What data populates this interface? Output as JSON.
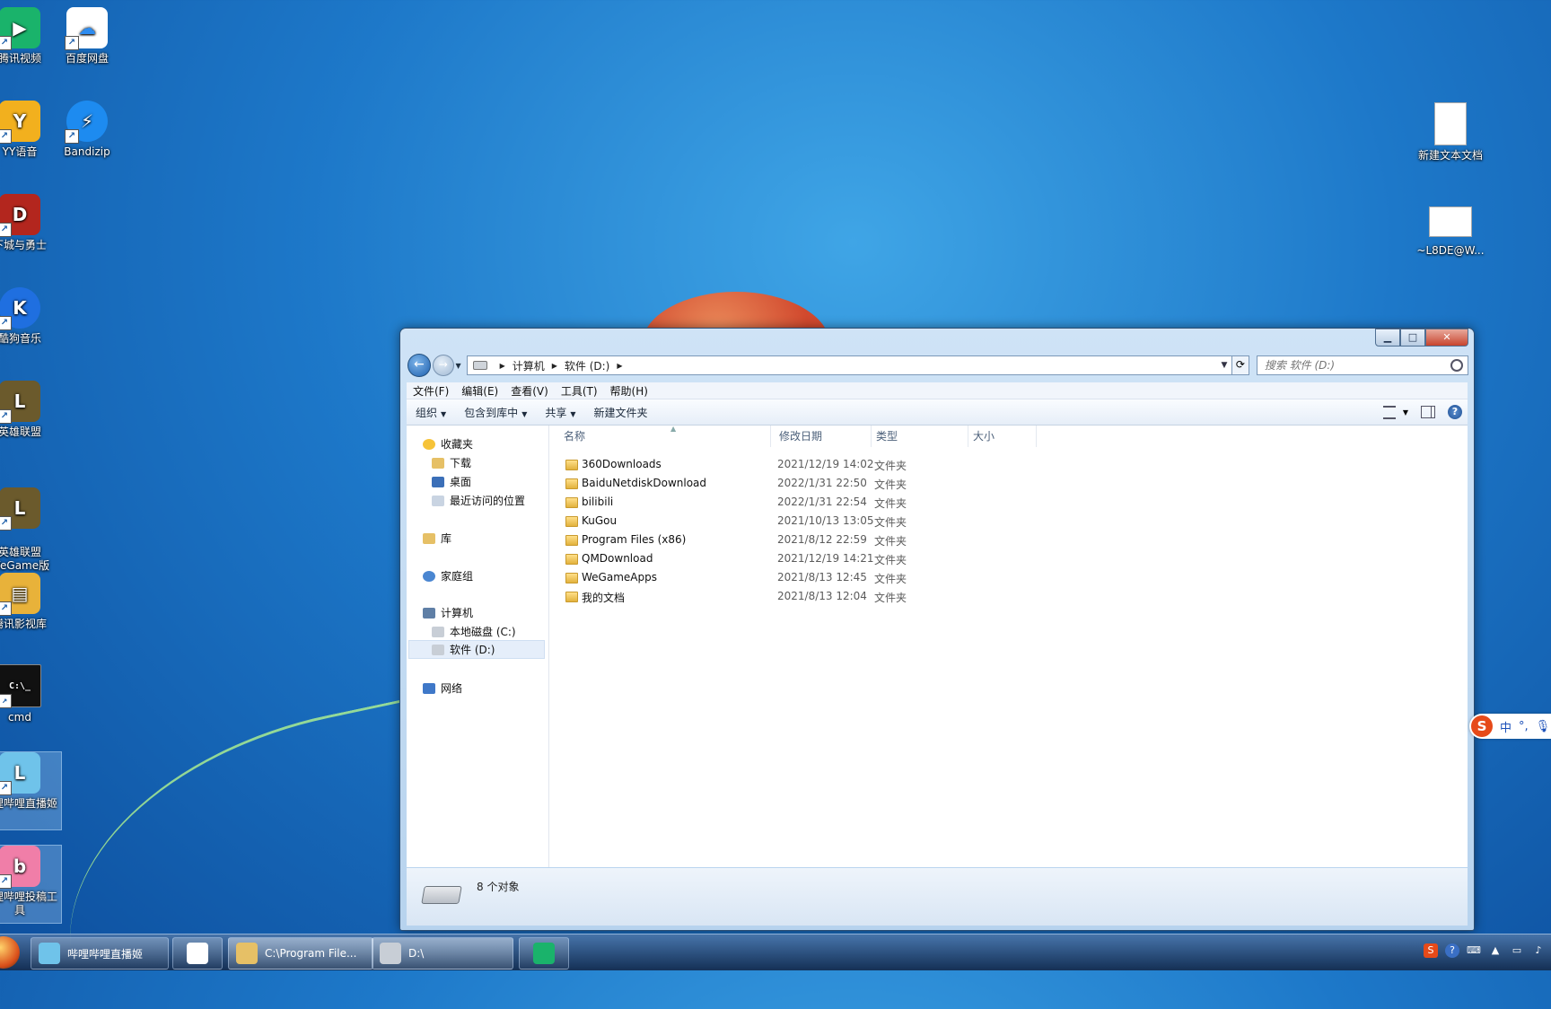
{
  "desktop": {
    "icons_left": [
      {
        "label": "腾讯视频",
        "icon": "tencent-video-icon",
        "color": "#1ab36b"
      },
      {
        "label": "YY语音",
        "icon": "yy-voice-icon",
        "color": "#f2b01e"
      },
      {
        "label": "下城与勇士",
        "icon": "dnf-game-icon",
        "color": "#b3261e"
      },
      {
        "label": "酷狗音乐",
        "icon": "kugou-music-icon",
        "color": "#1f6fe0"
      },
      {
        "label": "英雄联盟",
        "icon": "league-of-legends-icon",
        "color": "#6b5a2c"
      },
      {
        "label": "英雄联盟\nWeGame版",
        "icon": "league-wegame-icon",
        "color": "#6b5a2c"
      },
      {
        "label": "腾讯影视库",
        "icon": "tencent-film-library-icon",
        "color": "#e8b23a"
      },
      {
        "label": "cmd",
        "icon": "cmd-icon",
        "color": "#111111"
      },
      {
        "label": "哔哩哔哩直播姬",
        "icon": "bilibili-live-icon",
        "color": "#6fc3ea"
      },
      {
        "label": "哔哩哔哩投稿工具",
        "icon": "bilibili-upload-icon",
        "color": "#f07ea8"
      }
    ],
    "icons_col2": [
      {
        "label": "百度网盘",
        "icon": "baidu-netdisk-icon",
        "color": "#2d8cf0"
      },
      {
        "label": "Bandizip",
        "icon": "bandizip-icon",
        "color": "#1d8bf0"
      }
    ],
    "icons_right": [
      {
        "label": "新建文本文档",
        "icon": "text-document-icon"
      },
      {
        "label": "~L8DE@W...",
        "icon": "file-icon"
      }
    ]
  },
  "window": {
    "controls": {
      "minimize": "▁",
      "maximize": "□",
      "close": "✕"
    },
    "address": {
      "segments": [
        "计算机",
        "软件 (D:)"
      ]
    },
    "search_placeholder": "搜索 软件 (D:)",
    "menu": [
      "文件(F)",
      "编辑(E)",
      "查看(V)",
      "工具(T)",
      "帮助(H)"
    ],
    "toolbar": {
      "organize": "组织",
      "include_library": "包含到库中",
      "share": "共享",
      "new_folder": "新建文件夹"
    },
    "nav": {
      "favorites": "收藏夹",
      "favorites_items": [
        "下载",
        "桌面",
        "最近访问的位置"
      ],
      "libraries": "库",
      "homegroup": "家庭组",
      "computer": "计算机",
      "drives": [
        "本地磁盘 (C:)",
        "软件 (D:)"
      ],
      "network": "网络"
    },
    "columns": {
      "name": "名称",
      "date": "修改日期",
      "type": "类型",
      "size": "大小"
    },
    "files": [
      {
        "name": "360Downloads",
        "date": "2021/12/19 14:02",
        "type": "文件夹"
      },
      {
        "name": "BaiduNetdiskDownload",
        "date": "2022/1/31 22:50",
        "type": "文件夹"
      },
      {
        "name": "bilibili",
        "date": "2022/1/31 22:54",
        "type": "文件夹"
      },
      {
        "name": "KuGou",
        "date": "2021/10/13 13:05",
        "type": "文件夹"
      },
      {
        "name": "Program Files (x86)",
        "date": "2021/8/12 22:59",
        "type": "文件夹"
      },
      {
        "name": "QMDownload",
        "date": "2021/12/19 14:21",
        "type": "文件夹"
      },
      {
        "name": "WeGameApps",
        "date": "2021/8/13 12:45",
        "type": "文件夹"
      },
      {
        "name": "我的文档",
        "date": "2021/8/13 12:04",
        "type": "文件夹"
      }
    ],
    "status": "8 个对象"
  },
  "ime": {
    "logo": "S",
    "mode": "中",
    "punct": "°,"
  },
  "taskbar": {
    "tasks": [
      {
        "label": "哔哩哔哩直播姬",
        "icon": "bilibili-live-icon"
      },
      {
        "label": "",
        "icon": "baidu-netdisk-icon"
      },
      {
        "label": "C:\\Program File...",
        "icon": "folder-icon"
      },
      {
        "label": "D:\\",
        "icon": "drive-icon"
      },
      {
        "label": "",
        "icon": "tencent-video-icon"
      }
    ],
    "tray": [
      "sogou-ime-icon",
      "help-icon",
      "language-icon",
      "show-hidden-icon",
      "network-icon",
      "volume-icon"
    ]
  }
}
